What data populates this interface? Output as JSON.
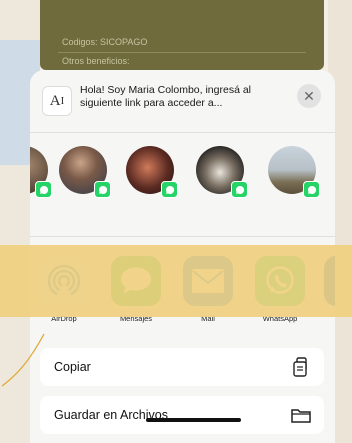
{
  "top_card": {
    "line1": "Codigos: SICOPAGO",
    "line2": "Otros beneficios:"
  },
  "share_sheet": {
    "preview_icon_text": "A͏I",
    "preview_text": "Hola! Soy Maria Colombo, ingresá al siguiente link para acceder a...",
    "apps": [
      {
        "label": "AirDrop",
        "icon": "airdrop-icon"
      },
      {
        "label": "Mensajes",
        "icon": "messages-icon"
      },
      {
        "label": "Mail",
        "icon": "mail-icon"
      },
      {
        "label": "WhatsApp",
        "icon": "whatsapp-icon"
      }
    ],
    "actions": [
      {
        "label": "Copiar",
        "icon": "copy-icon"
      },
      {
        "label": "Guardar en Archivos",
        "icon": "folder-icon"
      }
    ]
  },
  "colors": {
    "whatsapp_green": "#25d366",
    "messages_green": "#34c759",
    "mail_blue": "#2f8cf0",
    "airdrop_blue": "#3a9ad9",
    "band_yellow": "#efcf7d"
  }
}
